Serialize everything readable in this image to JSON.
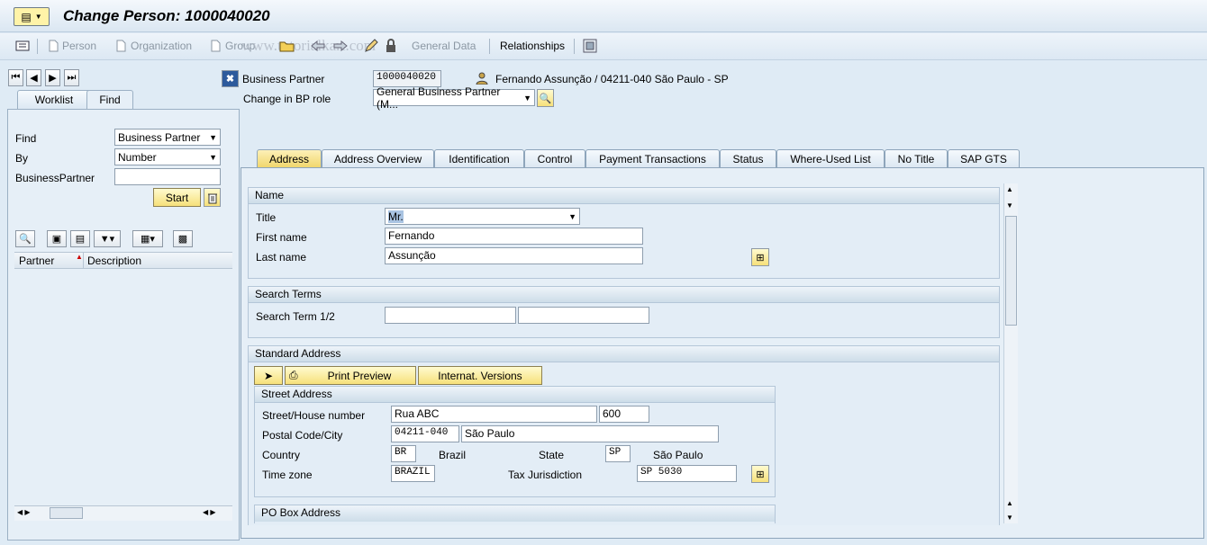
{
  "window": {
    "title": "Change Person: 1000040020"
  },
  "toolbar": {
    "person": "Person",
    "organization": "Organization",
    "group": "Group",
    "general_data": "General Data",
    "relationships": "Relationships",
    "watermark": "www.tutorialkart.com"
  },
  "left_panel": {
    "tabs": [
      "Worklist",
      "Find"
    ],
    "find_label": "Find",
    "find_value": "Business Partner",
    "by_label": "By",
    "by_value": "Number",
    "bp_label": "BusinessPartner",
    "bp_value": "",
    "start_button": "Start",
    "columns": [
      "Partner",
      "Description"
    ]
  },
  "header": {
    "bp_label": "Business Partner",
    "bp_number": "1000040020",
    "bp_description": "Fernando Assunção / 04211-040 São Paulo - SP",
    "role_label": "Change in BP role",
    "role_value": "General Business Partner (M..."
  },
  "tabs": [
    "Address",
    "Address Overview",
    "Identification",
    "Control",
    "Payment Transactions",
    "Status",
    "Where-Used List",
    "No Title",
    "SAP GTS"
  ],
  "name_section": {
    "heading": "Name",
    "title_label": "Title",
    "title_value": "Mr.",
    "first_name_label": "First name",
    "first_name_value": "Fernando",
    "last_name_label": "Last name",
    "last_name_value": "Assunção"
  },
  "search_terms": {
    "heading": "Search Terms",
    "label": "Search Term 1/2",
    "value1": "",
    "value2": ""
  },
  "standard_address": {
    "heading": "Standard Address",
    "print_preview": "Print Preview",
    "internat_versions": "Internat. Versions",
    "street_heading": "Street Address",
    "street_label": "Street/House number",
    "street_value": "Rua ABC",
    "house_number": "600",
    "postal_label": "Postal Code/City",
    "postal_value": "04211-040",
    "city_value": "São Paulo",
    "country_label": "Country",
    "country_code": "BR",
    "country_name": "Brazil",
    "state_label": "State",
    "state_code": "SP",
    "state_name": "São Paulo",
    "timezone_label": "Time zone",
    "timezone_value": "BRAZIL",
    "tax_label": "Tax Jurisdiction",
    "tax_value": "SP 5030",
    "po_box_heading": "PO Box Address"
  },
  "colors": {
    "accent_yellow": "#f6e07a",
    "panel_blue": "#dfebf5",
    "header_border": "#b4c6d8"
  }
}
